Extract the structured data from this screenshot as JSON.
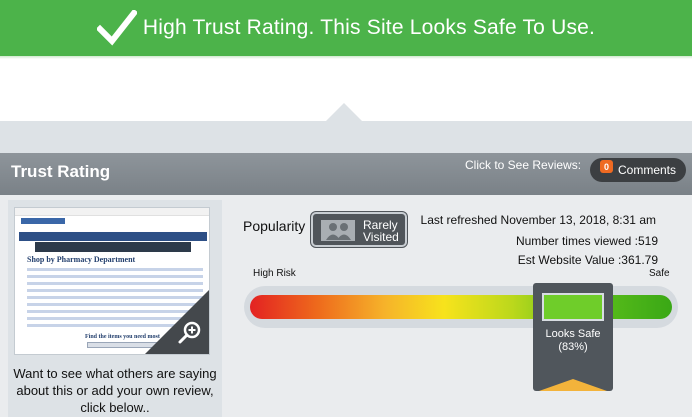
{
  "banner": {
    "text": "High Trust Rating. This Site Looks Safe To Use.",
    "icon": "checkmark-icon",
    "color": "#4cb34a"
  },
  "header": {
    "title": "Trust Rating",
    "reviews_prompt": "Click to See Reviews:",
    "comments_count": "0",
    "comments_label": "Comments"
  },
  "thumbnail": {
    "heading": "Shop by Pharmacy Department",
    "footer": "Find the items you need most",
    "zoom_icon": "magnifier-plus-icon"
  },
  "caption": "Want to see what others are saying about this or add your own review, click below..",
  "popularity": {
    "label": "Popularity",
    "status": "Rarely Visited",
    "status_line1": "Rarely",
    "status_line2": "Visited",
    "icon": "people-icon"
  },
  "stats": {
    "refreshed": "Last refreshed November 13, 2018, 8:31 am",
    "views": "Number times viewed :519",
    "value": "Est Website Value :361.79"
  },
  "meter": {
    "low_label": "High Risk",
    "high_label": "Safe",
    "verdict": "Looks Safe",
    "percent_text": "(83%)",
    "percent": 83
  }
}
